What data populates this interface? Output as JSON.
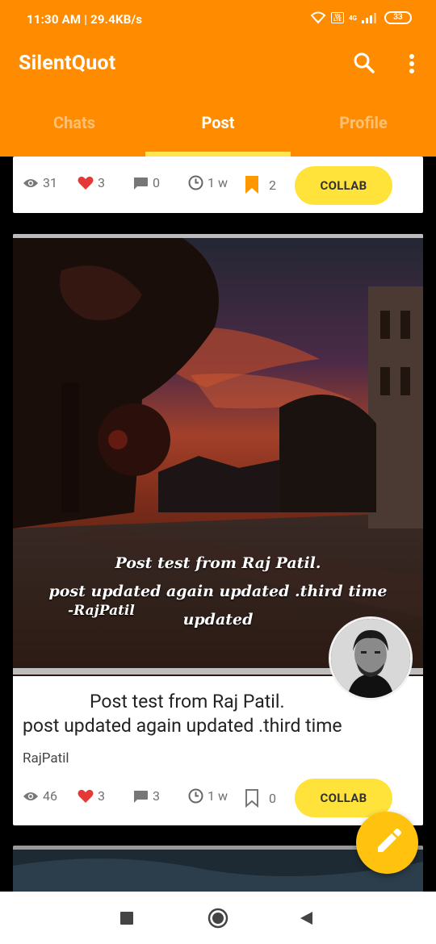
{
  "status_bar": {
    "time": "11:30 AM | 29.4KB/s",
    "lte_label": "Vo LTE",
    "network": "4G",
    "battery": "33"
  },
  "app_bar": {
    "title": "SilentQuot",
    "background_color": "#FF8C00"
  },
  "tabs": [
    {
      "label": "Chats",
      "selected": false
    },
    {
      "label": "Post",
      "selected": true
    },
    {
      "label": "Profile",
      "selected": false
    }
  ],
  "posts": [
    {
      "views": "31",
      "likes": "3",
      "comments": "0",
      "time": "1 w",
      "bookmarks": "2",
      "bookmarked": true,
      "collab_label": "COLLAB"
    },
    {
      "image_text_line1": "Post test from Raj Patil.",
      "image_text_line2": "post  updated again updated .third time updated",
      "image_signature": "-RajPatil",
      "caption_line1": "Post test from Raj Patil.",
      "caption_line2": "post  updated again updated .third time",
      "author": "RajPatil",
      "views": "46",
      "likes": "3",
      "comments": "3",
      "time": "1 w",
      "bookmarks": "0",
      "bookmarked": false,
      "collab_label": "COLLAB"
    }
  ],
  "fab": {
    "icon": "pencil-icon",
    "color": "#FFC20E"
  },
  "colors": {
    "accent": "#FFE33A",
    "like": "#E53935",
    "bookmark": "#FF9800"
  }
}
